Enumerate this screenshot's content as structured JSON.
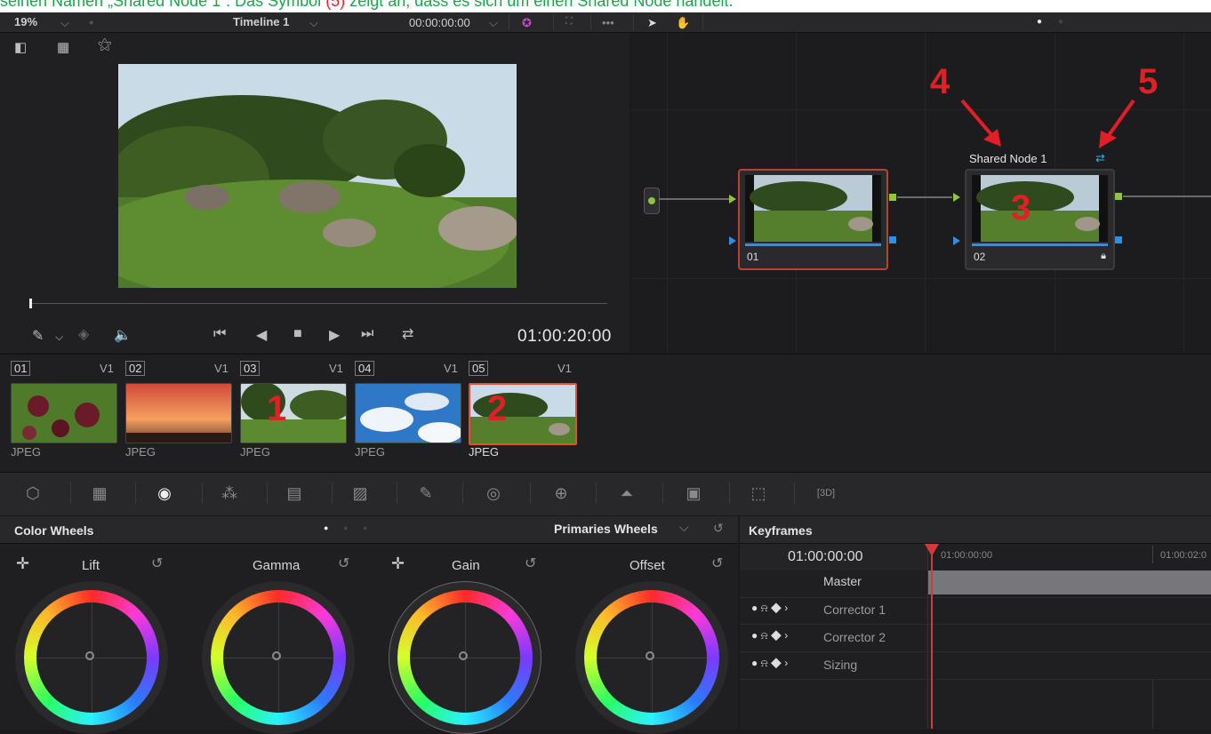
{
  "caption": {
    "text_before": "seinen Namen „Shared Node 1“. Das Symbol ",
    "marker": "(5)",
    "text_after": " zeigt an, dass es sich um einen Shared Node handelt."
  },
  "topbar": {
    "zoom": "19%",
    "timeline_name": "Timeline 1",
    "timecode": "00:00:00:00"
  },
  "viewer": {
    "timecode": "01:00:20:00"
  },
  "node_editor": {
    "node1": {
      "label": "01"
    },
    "node2": {
      "label": "02",
      "title": "Shared Node 1"
    }
  },
  "annotations": {
    "n1": "1",
    "n2": "2",
    "n3": "3",
    "n4": "4",
    "n5": "5"
  },
  "clips": [
    {
      "num": "01",
      "track": "V1",
      "type": "JPEG"
    },
    {
      "num": "02",
      "track": "V1",
      "type": "JPEG"
    },
    {
      "num": "03",
      "track": "V1",
      "type": "JPEG"
    },
    {
      "num": "04",
      "track": "V1",
      "type": "JPEG"
    },
    {
      "num": "05",
      "track": "V1",
      "type": "JPEG"
    }
  ],
  "color_wheels": {
    "title": "Color Wheels",
    "mode": "Primaries Wheels",
    "wheels": [
      {
        "label": "Lift"
      },
      {
        "label": "Gamma"
      },
      {
        "label": "Gain"
      },
      {
        "label": "Offset"
      }
    ]
  },
  "keyframes": {
    "title": "Keyframes",
    "timecode": "01:00:00:00",
    "ruler_start": "01:00:00:00",
    "ruler_next": "01:00:02:0",
    "master": "Master",
    "rows": [
      {
        "name": "Corrector 1"
      },
      {
        "name": "Corrector 2"
      },
      {
        "name": "Sizing"
      }
    ]
  },
  "colors": {
    "accent_red": "#e21e26",
    "caption_green": "#1aa64b",
    "node_selected": "#b8432f",
    "port_green": "#8cc63f",
    "port_blue": "#2f8fe0"
  }
}
